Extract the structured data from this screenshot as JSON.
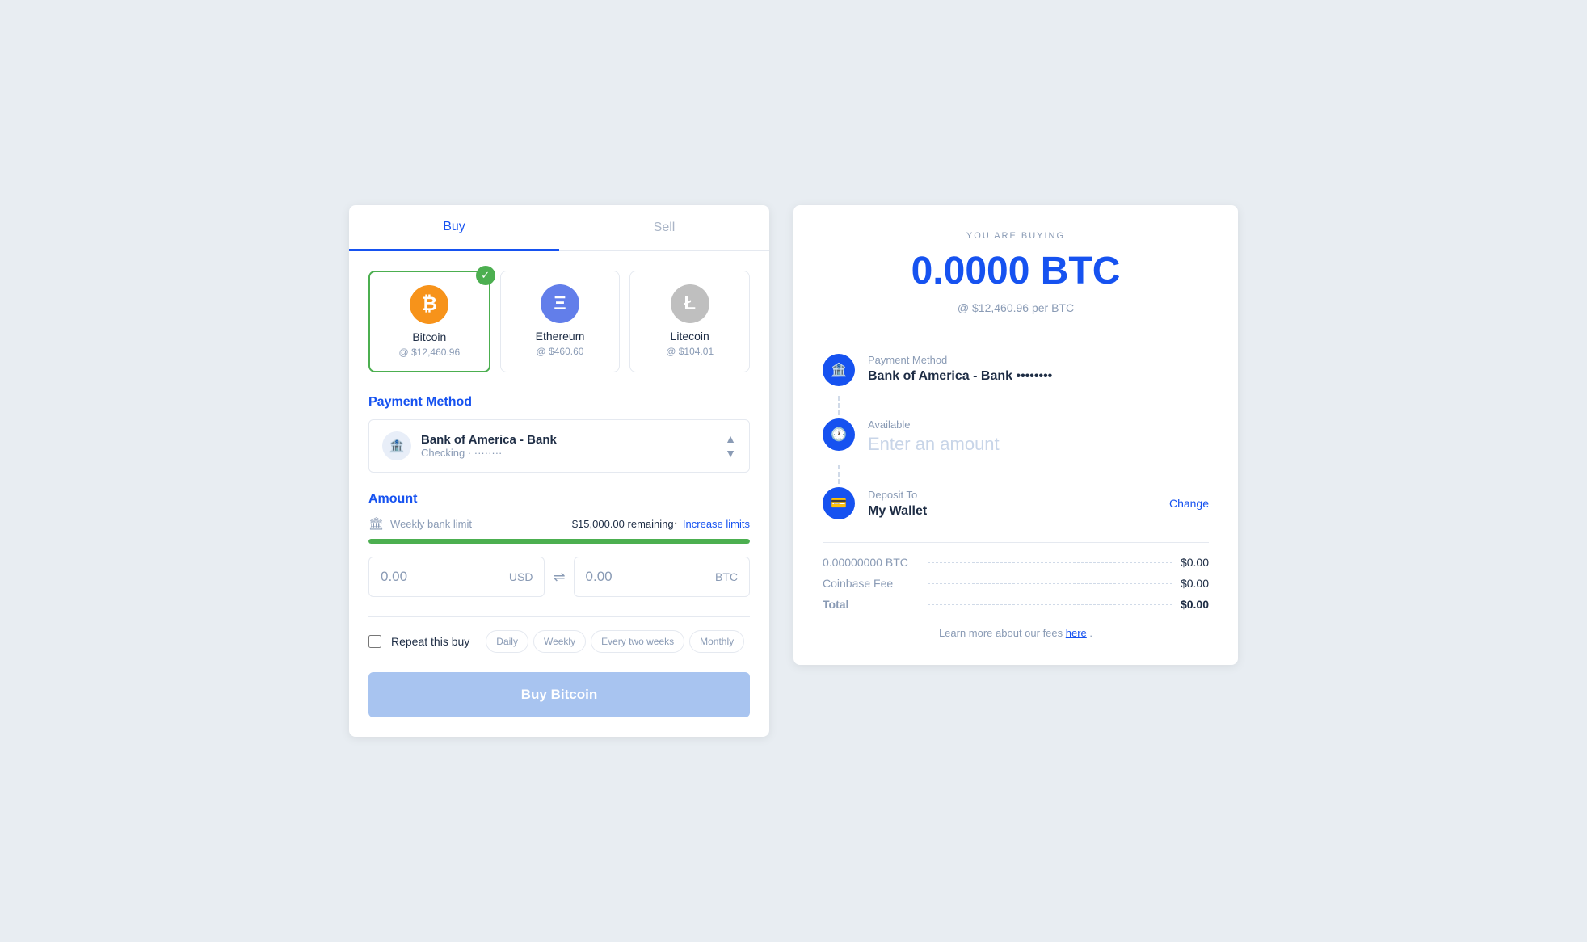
{
  "tabs": {
    "buy": "Buy",
    "sell": "Sell"
  },
  "cryptos": [
    {
      "id": "btc",
      "name": "Bitcoin",
      "price": "@ $12,460.96",
      "selected": true,
      "symbol": "₿",
      "iconClass": "btc-icon"
    },
    {
      "id": "eth",
      "name": "Ethereum",
      "price": "@ $460.60",
      "selected": false,
      "symbol": "Ξ",
      "iconClass": "eth-icon"
    },
    {
      "id": "ltc",
      "name": "Litecoin",
      "price": "@ $104.01",
      "selected": false,
      "symbol": "Ł",
      "iconClass": "ltc-icon"
    }
  ],
  "paymentMethod": {
    "sectionTitle": "Payment Method",
    "bankName": "Bank of America - Bank",
    "bankSub": "Checking · ········"
  },
  "amount": {
    "sectionTitle": "Amount",
    "limitLabel": "Weekly bank limit",
    "limitRemaining": "$15,000.00 remaining",
    "increaseLink": "Increase limits",
    "usdValue": "0.00",
    "usdCurrency": "USD",
    "btcValue": "0.00",
    "btcCurrency": "BTC"
  },
  "repeat": {
    "label": "Repeat this buy",
    "options": [
      "Daily",
      "Weekly",
      "Every two weeks",
      "Monthly"
    ]
  },
  "buyButton": "Buy Bitcoin",
  "receipt": {
    "youAreBuying": "YOU ARE BUYING",
    "btcAmount": "0.0000 BTC",
    "rateLabel": "@ $12,460.96 per BTC",
    "paymentMethod": {
      "label": "Payment Method",
      "value": "Bank of America - Bank ••••••••"
    },
    "available": {
      "label": "Available",
      "placeholder": "Enter an amount"
    },
    "depositTo": {
      "label": "Deposit To",
      "value": "My Wallet",
      "changeLink": "Change"
    },
    "fees": {
      "btcAmount": "0.00000000 BTC",
      "btcValue": "$0.00",
      "coinbaseFeeLabel": "Coinbase Fee",
      "coinbaseFeeValue": "$0.00",
      "totalLabel": "Total",
      "totalValue": "$0.00"
    },
    "footerText": "Learn more about our fees ",
    "footerLink": "here",
    "footerPeriod": "."
  }
}
